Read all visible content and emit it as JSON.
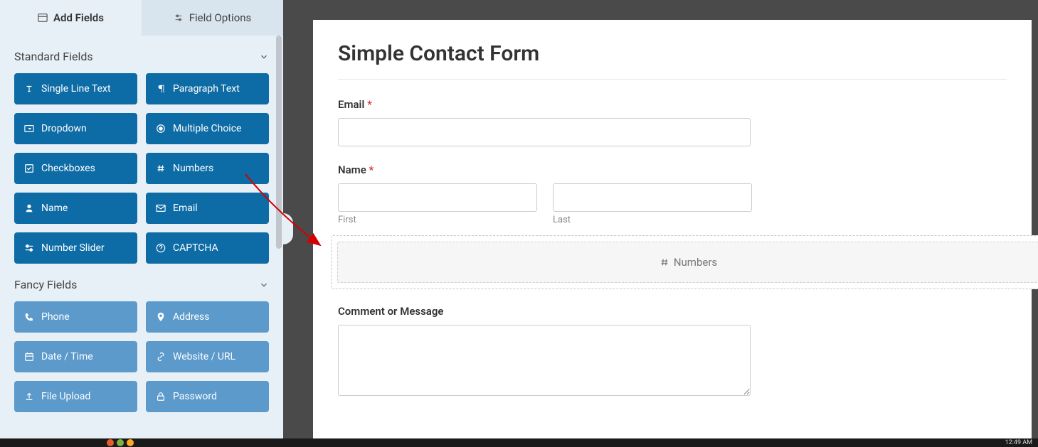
{
  "tabs": {
    "add_fields": "Add Fields",
    "field_options": "Field Options"
  },
  "sections": {
    "standard": "Standard Fields",
    "fancy": "Fancy Fields"
  },
  "standard_fields": [
    {
      "label": "Single Line Text",
      "icon": "text"
    },
    {
      "label": "Paragraph Text",
      "icon": "paragraph"
    },
    {
      "label": "Dropdown",
      "icon": "dropdown"
    },
    {
      "label": "Multiple Choice",
      "icon": "radio"
    },
    {
      "label": "Checkboxes",
      "icon": "check"
    },
    {
      "label": "Numbers",
      "icon": "hash"
    },
    {
      "label": "Name",
      "icon": "user"
    },
    {
      "label": "Email",
      "icon": "mail"
    },
    {
      "label": "Number Slider",
      "icon": "slider"
    },
    {
      "label": "CAPTCHA",
      "icon": "help"
    }
  ],
  "fancy_fields": [
    {
      "label": "Phone",
      "icon": "phone"
    },
    {
      "label": "Address",
      "icon": "pin"
    },
    {
      "label": "Date / Time",
      "icon": "calendar"
    },
    {
      "label": "Website / URL",
      "icon": "link"
    },
    {
      "label": "File Upload",
      "icon": "upload"
    },
    {
      "label": "Password",
      "icon": "lock"
    }
  ],
  "form": {
    "title": "Simple Contact Form",
    "fields": {
      "email": {
        "label": "Email"
      },
      "name": {
        "label": "Name",
        "first_sub": "First",
        "last_sub": "Last"
      },
      "drop": {
        "label": "Numbers"
      },
      "comment": {
        "label": "Comment or Message"
      }
    }
  },
  "taskbar": {
    "time": "12:49 AM"
  }
}
